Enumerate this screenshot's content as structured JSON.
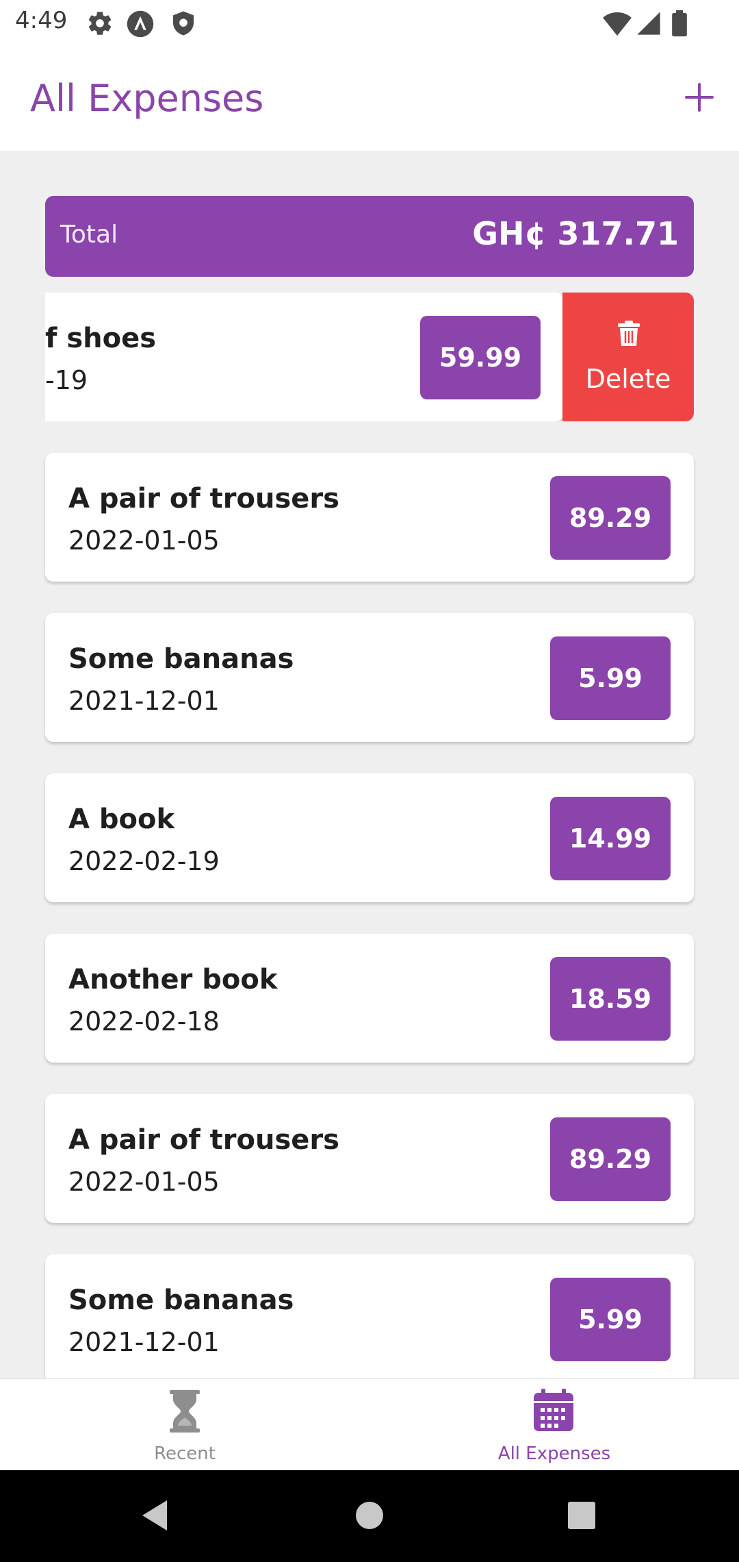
{
  "status_bar": {
    "time": "4:49",
    "icons": [
      "settings-gear-icon",
      "app-a-icon",
      "shield-icon",
      "wifi-icon",
      "signal-icon",
      "battery-icon"
    ]
  },
  "header": {
    "title": "All Expenses",
    "add_icon": "plus-icon"
  },
  "total": {
    "label": "Total",
    "value": "GH¢ 317.71"
  },
  "swiped_item": {
    "title": "f shoes",
    "date": "-19",
    "amount": "59.99",
    "delete_label": "Delete",
    "delete_icon": "trash-icon"
  },
  "expenses": [
    {
      "title": "A pair of trousers",
      "date": "2022-01-05",
      "amount": "89.29"
    },
    {
      "title": "Some bananas",
      "date": "2021-12-01",
      "amount": "5.99"
    },
    {
      "title": "A book",
      "date": "2022-02-19",
      "amount": "14.99"
    },
    {
      "title": "Another book",
      "date": "2022-02-18",
      "amount": "18.59"
    },
    {
      "title": "A pair of trousers",
      "date": "2022-01-05",
      "amount": "89.29"
    },
    {
      "title": "Some bananas",
      "date": "2021-12-01",
      "amount": "5.99"
    }
  ],
  "bottom_nav": {
    "tabs": [
      {
        "label": "Recent",
        "icon": "hourglass-icon",
        "active": false
      },
      {
        "label": "All Expenses",
        "icon": "calendar-icon",
        "active": true
      }
    ]
  },
  "colors": {
    "accent": "#8a44ab",
    "delete": "#ef4444",
    "background": "#efefef",
    "inactive_nav": "#8e8e8e"
  }
}
